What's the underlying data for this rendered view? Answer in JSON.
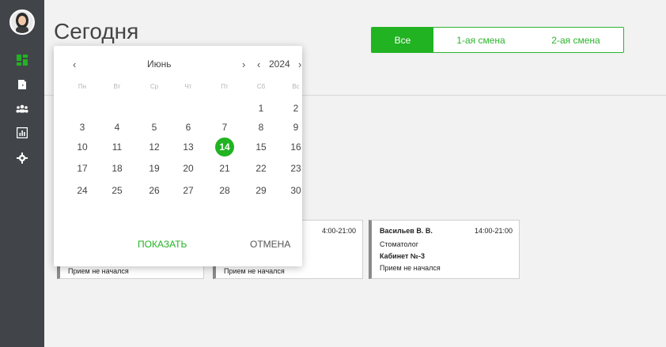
{
  "page": {
    "title": "Сегодня"
  },
  "sidebar": {
    "items": [
      {
        "icon": "dashboard-icon",
        "active": true
      },
      {
        "icon": "door-icon"
      },
      {
        "icon": "users-icon"
      },
      {
        "icon": "chart-icon"
      },
      {
        "icon": "gear-icon"
      }
    ]
  },
  "shifts": {
    "all": "Все",
    "first": "1-ая смена",
    "second": "2-ая смена"
  },
  "calendar": {
    "month": "Июнь",
    "year": "2024",
    "prev": "‹",
    "next": "›",
    "weekdays": [
      "Пн",
      "Вт",
      "Ср",
      "Чт",
      "Пт",
      "Сб",
      "Вс"
    ],
    "days": [
      "1",
      "2",
      "3",
      "4",
      "5",
      "6",
      "7",
      "8",
      "9",
      "10",
      "11",
      "12",
      "13",
      "14",
      "15",
      "16",
      "17",
      "18",
      "19",
      "20",
      "21",
      "22",
      "23",
      "24",
      "25",
      "26",
      "27",
      "28",
      "29",
      "30"
    ],
    "selected": "14",
    "show": "ПОКАЗАТЬ",
    "cancel": "ОТМЕНА"
  },
  "cards": [
    {
      "status": "Прием не начался"
    },
    {
      "time": "4:00-21:00",
      "status": "Прием не начался"
    },
    {
      "name": "Васильев В. В.",
      "time": "14:00-21:00",
      "specialty": "Стоматолог",
      "cabinet": "Кабинет №-3",
      "status": "Прием не начался"
    }
  ],
  "colors": {
    "accent": "#21b321",
    "sidebar": "#414549"
  }
}
